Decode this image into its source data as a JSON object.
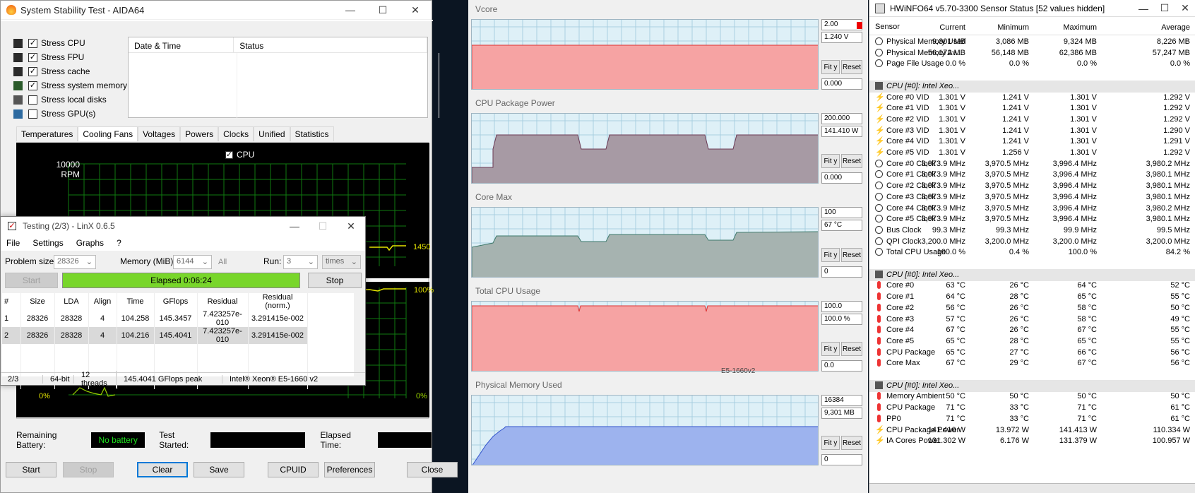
{
  "aida": {
    "title": "System Stability Test - AIDA64",
    "stress": [
      {
        "label": "Stress CPU",
        "checked": true
      },
      {
        "label": "Stress FPU",
        "checked": true
      },
      {
        "label": "Stress cache",
        "checked": true
      },
      {
        "label": "Stress system memory",
        "checked": true
      },
      {
        "label": "Stress local disks",
        "checked": false
      },
      {
        "label": "Stress GPU(s)",
        "checked": false
      }
    ],
    "log_headers": [
      "Date & Time",
      "Status"
    ],
    "tabs": [
      "Temperatures",
      "Cooling Fans",
      "Voltages",
      "Powers",
      "Clocks",
      "Unified",
      "Statistics"
    ],
    "active_tab": "Cooling Fans",
    "fan_graph": {
      "series_label": "CPU",
      "ytop": "10000",
      "yunit": "RPM",
      "value_label": "1450"
    },
    "usage_graph": {
      "top_label": "100%",
      "bottom_left": "0%",
      "bottom_right": "0%"
    },
    "remaining_battery_label": "Remaining Battery:",
    "battery_value": "No battery",
    "test_started_label": "Test Started:",
    "elapsed_label": "Elapsed Time:",
    "buttons": {
      "start": "Start",
      "stop": "Stop",
      "clear": "Clear",
      "save": "Save",
      "cpuid": "CPUID",
      "preferences": "Preferences",
      "close": "Close"
    }
  },
  "linx": {
    "title": "Testing (2/3) - LinX 0.6.5",
    "menu": [
      "File",
      "Settings",
      "Graphs",
      "?"
    ],
    "problem_size_label": "Problem size:",
    "problem_size": "28326",
    "memory_label": "Memory (MiB):",
    "memory": "6144",
    "all": "All",
    "run_label": "Run:",
    "run": "3",
    "times": "times",
    "start": "Start",
    "elapsed": "Elapsed 0:06:24",
    "stop": "Stop",
    "headers": [
      "#",
      "Size",
      "LDA",
      "Align",
      "Time",
      "GFlops",
      "Residual",
      "Residual (norm.)"
    ],
    "rows": [
      [
        "1",
        "28326",
        "28328",
        "4",
        "104.258",
        "145.3457",
        "7.423257e-010",
        "3.291415e-002"
      ],
      [
        "2",
        "28326",
        "28328",
        "4",
        "104.216",
        "145.4041",
        "7.423257e-010",
        "3.291415e-002"
      ]
    ],
    "status": [
      "2/3",
      "64-bit",
      "12 threads",
      "145.4041 GFlops peak",
      "Intel® Xeon® E5-1660 v2"
    ]
  },
  "monitor": {
    "panels": [
      {
        "title": "Vcore",
        "top": "2.00",
        "current": "1.240 V",
        "bottom": "0.000",
        "color": "#f6a3a3",
        "line": "#d33"
      },
      {
        "title": "CPU Package Power",
        "top": "200.000",
        "current": "141.410 W",
        "bottom": "0.000",
        "color": "#a79aa4",
        "line": "#6c3a55"
      },
      {
        "title": "Core Max",
        "top": "100",
        "current": "67 °C",
        "bottom": "0",
        "color": "#a6b3b0",
        "line": "#3f7a6c"
      },
      {
        "title": "Total CPU Usage",
        "top": "100.0",
        "current": "100.0 %",
        "bottom": "0.0",
        "color": "#f6a3a3",
        "line": "#d33"
      },
      {
        "title": "Physical Memory Used",
        "top": "16384",
        "current": "9,301 MB",
        "bottom": "0",
        "color": "#9db3ee",
        "line": "#3355cc"
      }
    ],
    "fit": "Fit y",
    "reset": "Reset",
    "cpu_name": "E5-1660v2"
  },
  "hwinfo": {
    "title": "HWiNFO64 v5.70-3300 Sensor Status [52 values hidden]",
    "headers": [
      "Sensor",
      "Current",
      "Minimum",
      "Maximum",
      "Average"
    ],
    "rows": [
      {
        "t": "m",
        "name": "Physical Memory Used",
        "v": [
          "9,301 MB",
          "3,086 MB",
          "9,324 MB",
          "8,226 MB"
        ]
      },
      {
        "t": "m",
        "name": "Physical Memory Av...",
        "v": [
          "56,172 MB",
          "56,148 MB",
          "62,386 MB",
          "57,247 MB"
        ]
      },
      {
        "t": "m",
        "name": "Page File Usage",
        "v": [
          "0.0 %",
          "0.0 %",
          "0.0 %",
          "0.0 %"
        ]
      },
      {
        "t": "e"
      },
      {
        "t": "g",
        "name": "CPU [#0]: Intel Xeo..."
      },
      {
        "t": "v",
        "name": "Core #0 VID",
        "v": [
          "1.301 V",
          "1.241 V",
          "1.301 V",
          "1.292 V"
        ]
      },
      {
        "t": "v",
        "name": "Core #1 VID",
        "v": [
          "1.301 V",
          "1.241 V",
          "1.301 V",
          "1.292 V"
        ]
      },
      {
        "t": "v",
        "name": "Core #2 VID",
        "v": [
          "1.301 V",
          "1.241 V",
          "1.301 V",
          "1.292 V"
        ]
      },
      {
        "t": "v",
        "name": "Core #3 VID",
        "v": [
          "1.301 V",
          "1.241 V",
          "1.301 V",
          "1.290 V"
        ]
      },
      {
        "t": "v",
        "name": "Core #4 VID",
        "v": [
          "1.301 V",
          "1.241 V",
          "1.301 V",
          "1.291 V"
        ]
      },
      {
        "t": "v",
        "name": "Core #5 VID",
        "v": [
          "1.301 V",
          "1.256 V",
          "1.301 V",
          "1.292 V"
        ]
      },
      {
        "t": "m",
        "name": "Core #0 Clock",
        "v": [
          "3,973.9 MHz",
          "3,970.5 MHz",
          "3,996.4 MHz",
          "3,980.2 MHz"
        ]
      },
      {
        "t": "m",
        "name": "Core #1 Clock",
        "v": [
          "3,973.9 MHz",
          "3,970.5 MHz",
          "3,996.4 MHz",
          "3,980.1 MHz"
        ]
      },
      {
        "t": "m",
        "name": "Core #2 Clock",
        "v": [
          "3,973.9 MHz",
          "3,970.5 MHz",
          "3,996.4 MHz",
          "3,980.1 MHz"
        ]
      },
      {
        "t": "m",
        "name": "Core #3 Clock",
        "v": [
          "3,973.9 MHz",
          "3,970.5 MHz",
          "3,996.4 MHz",
          "3,980.1 MHz"
        ]
      },
      {
        "t": "m",
        "name": "Core #4 Clock",
        "v": [
          "3,973.9 MHz",
          "3,970.5 MHz",
          "3,996.4 MHz",
          "3,980.2 MHz"
        ]
      },
      {
        "t": "m",
        "name": "Core #5 Clock",
        "v": [
          "3,973.9 MHz",
          "3,970.5 MHz",
          "3,996.4 MHz",
          "3,980.1 MHz"
        ]
      },
      {
        "t": "m",
        "name": "Bus Clock",
        "v": [
          "99.3 MHz",
          "99.3 MHz",
          "99.9 MHz",
          "99.5 MHz"
        ]
      },
      {
        "t": "m",
        "name": "QPI Clock",
        "v": [
          "3,200.0 MHz",
          "3,200.0 MHz",
          "3,200.0 MHz",
          "3,200.0 MHz"
        ]
      },
      {
        "t": "m",
        "name": "Total CPU Usage",
        "v": [
          "100.0 %",
          "0.4 %",
          "100.0 %",
          "84.2 %"
        ]
      },
      {
        "t": "e"
      },
      {
        "t": "g",
        "name": "CPU [#0]: Intel Xeo..."
      },
      {
        "t": "th",
        "name": "Core #0",
        "v": [
          "63 °C",
          "26 °C",
          "64 °C",
          "52 °C"
        ]
      },
      {
        "t": "th",
        "name": "Core #1",
        "v": [
          "64 °C",
          "28 °C",
          "65 °C",
          "55 °C"
        ]
      },
      {
        "t": "th",
        "name": "Core #2",
        "v": [
          "56 °C",
          "26 °C",
          "58 °C",
          "50 °C"
        ]
      },
      {
        "t": "th",
        "name": "Core #3",
        "v": [
          "57 °C",
          "26 °C",
          "58 °C",
          "49 °C"
        ]
      },
      {
        "t": "th",
        "name": "Core #4",
        "v": [
          "67 °C",
          "26 °C",
          "67 °C",
          "55 °C"
        ]
      },
      {
        "t": "th",
        "name": "Core #5",
        "v": [
          "65 °C",
          "28 °C",
          "65 °C",
          "55 °C"
        ]
      },
      {
        "t": "th",
        "name": "CPU Package",
        "v": [
          "65 °C",
          "27 °C",
          "66 °C",
          "56 °C"
        ]
      },
      {
        "t": "th",
        "name": "Core Max",
        "v": [
          "67 °C",
          "29 °C",
          "67 °C",
          "56 °C"
        ]
      },
      {
        "t": "e"
      },
      {
        "t": "g",
        "name": "CPU [#0]: Intel Xeo..."
      },
      {
        "t": "th",
        "name": "Memory Ambient",
        "v": [
          "50 °C",
          "50 °C",
          "50 °C",
          "50 °C"
        ]
      },
      {
        "t": "th",
        "name": "CPU Package",
        "v": [
          "71 °C",
          "33 °C",
          "71 °C",
          "61 °C"
        ]
      },
      {
        "t": "th",
        "name": "PP0",
        "v": [
          "71 °C",
          "33 °C",
          "71 °C",
          "61 °C"
        ]
      },
      {
        "t": "v",
        "name": "CPU Package Power",
        "v": [
          "141.410 W",
          "13.972 W",
          "141.413 W",
          "110.334 W"
        ]
      },
      {
        "t": "v",
        "name": "IA Cores Power",
        "v": [
          "131.302 W",
          "6.176 W",
          "131.379 W",
          "100.957 W"
        ]
      }
    ]
  }
}
